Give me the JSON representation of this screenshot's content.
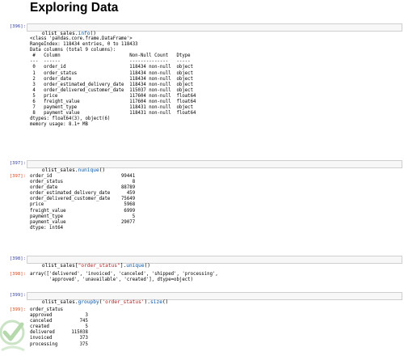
{
  "page": {
    "heading": "Exploring Data"
  },
  "cells": [
    {
      "in_prompt": "[396]:",
      "code": [
        {
          "text": "olist_sales.",
          "kind": "plain"
        },
        {
          "text": "info",
          "kind": "fn"
        },
        {
          "text": "()",
          "kind": "plain"
        }
      ],
      "out_prompt": "",
      "output": "<class 'pandas.core.frame.DataFrame'>\nRangeIndex: 118434 entries, 0 to 118433\nData columns (total 9 columns):\n #   Column                         Non-Null Count   Dtype  \n---  ------                         --------------   -----  \n 0   order_id                       118434 non-null  object \n 1   order_status                   118434 non-null  object \n 2   order_date                     118434 non-null  object \n 3   order_estimated_delivery_date  118434 non-null  object \n 4   order_delivered_customer_date  115037 non-null  object \n 5   price                          117604 non-null  float64\n 6   freight_value                  117604 non-null  float64\n 7   payment_type                   118431 non-null  object \n 8   payment_value                  118431 non-null  float64\ndtypes: float64(3), object(6)\nmemory usage: 8.1+ MB"
    },
    {
      "in_prompt": "[397]:",
      "code": [
        {
          "text": "olist_sales.",
          "kind": "plain"
        },
        {
          "text": "nunique",
          "kind": "fn"
        },
        {
          "text": "()",
          "kind": "plain"
        }
      ],
      "out_prompt": "[397]:",
      "output": "order_id                         99441\norder_status                         8\norder_date                       88789\norder_estimated_delivery_date      459\norder_delivered_customer_date    75649\nprice                             5968\nfreight_value                     6999\npayment_type                         5\npayment_value                    29077\ndtype: int64"
    },
    {
      "in_prompt": "[398]:",
      "code": [
        {
          "text": "olist_sales[",
          "kind": "plain"
        },
        {
          "text": "\"order_status\"",
          "kind": "str"
        },
        {
          "text": "].",
          "kind": "plain"
        },
        {
          "text": "unique",
          "kind": "fn"
        },
        {
          "text": "()",
          "kind": "plain"
        }
      ],
      "out_prompt": "[398]:",
      "output": "array(['delivered', 'invoiced', 'canceled', 'shipped', 'processing',\n       'approved', 'unavailable', 'created'], dtype=object)"
    },
    {
      "in_prompt": "[399]:",
      "code": [
        {
          "text": "olist_sales.",
          "kind": "plain"
        },
        {
          "text": "groupby",
          "kind": "fn"
        },
        {
          "text": "(",
          "kind": "plain"
        },
        {
          "text": "'order_status'",
          "kind": "str"
        },
        {
          "text": ").",
          "kind": "plain"
        },
        {
          "text": "size",
          "kind": "fn"
        },
        {
          "text": "()",
          "kind": "plain"
        }
      ],
      "out_prompt": "[399]:",
      "output": "order_status\napproved            3\ncanceled          745\ncreated             5\ndelivered      115038\ninvoiced          373\nprocessing        375"
    }
  ],
  "colors": {
    "prompt_in": "#303f9f",
    "prompt_out": "#d84315",
    "function": "#0055aa",
    "string": "#b22222",
    "cell_bg": "#f7f7f7",
    "cell_border": "#cfcfcf"
  },
  "icons": {
    "watermark": "check-shield-logo"
  }
}
